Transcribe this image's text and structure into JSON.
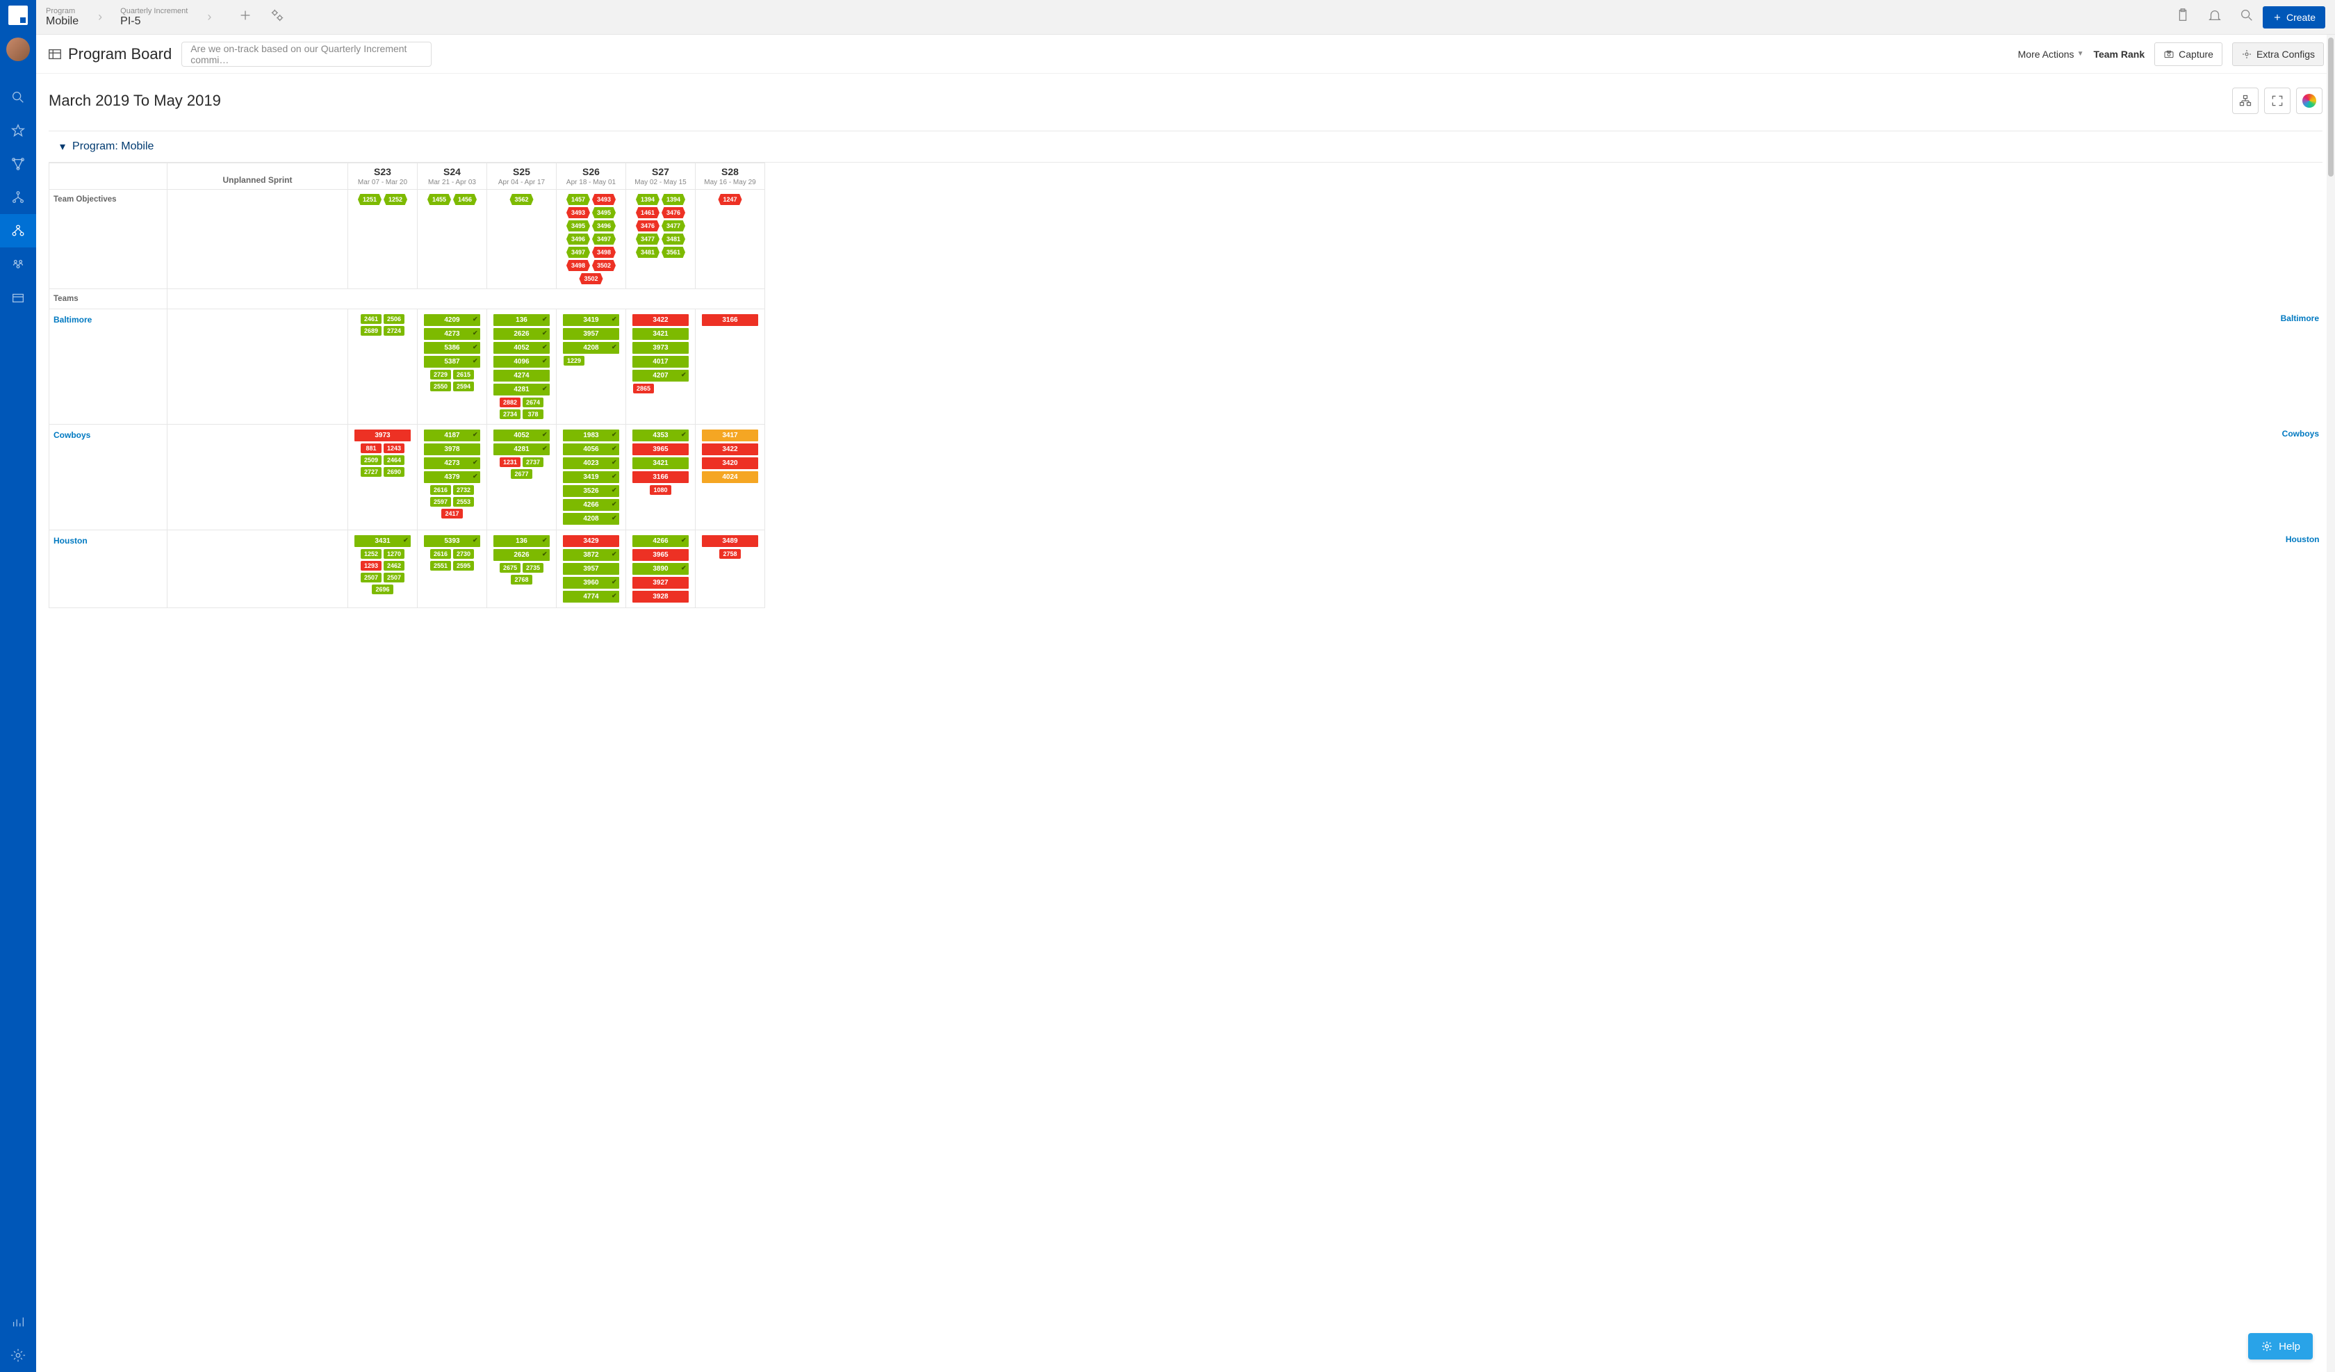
{
  "breadcrumbs": {
    "program_label": "Program",
    "program_value": "Mobile",
    "pi_label": "Quarterly Increment",
    "pi_value": "PI-5"
  },
  "header": {
    "create_label": "Create"
  },
  "page": {
    "title": "Program Board",
    "search_placeholder": "Are we on-track based on our Quarterly Increment commi…",
    "more_actions": "More Actions",
    "team_rank": "Team Rank",
    "capture": "Capture",
    "extra_configs": "Extra Configs",
    "date_range": "March 2019 To May 2019",
    "section_title": "Program: Mobile",
    "help": "Help"
  },
  "columns": {
    "unplanned": "Unplanned Sprint",
    "sprints": [
      {
        "name": "S23",
        "dates": "Mar 07 - Mar 20"
      },
      {
        "name": "S24",
        "dates": "Mar 21 - Apr 03"
      },
      {
        "name": "S25",
        "dates": "Apr 04 - Apr 17"
      },
      {
        "name": "S26",
        "dates": "Apr 18 - May 01"
      },
      {
        "name": "S27",
        "dates": "May 02 - May 15"
      },
      {
        "name": "S28",
        "dates": "May 16 - May 29"
      }
    ]
  },
  "rows": {
    "team_objectives_label": "Team Objectives",
    "teams_label": "Teams",
    "objectives": {
      "S23": [
        {
          "id": "1251",
          "c": "green"
        },
        {
          "id": "1252",
          "c": "green"
        }
      ],
      "S24": [
        {
          "id": "1455",
          "c": "green"
        },
        {
          "id": "1456",
          "c": "green"
        }
      ],
      "S25": [
        {
          "id": "3562",
          "c": "green"
        }
      ],
      "S26": [
        {
          "id": "1457",
          "c": "green"
        },
        {
          "id": "3493",
          "c": "red"
        },
        {
          "id": "3493",
          "c": "red"
        },
        {
          "id": "3495",
          "c": "green"
        },
        {
          "id": "3495",
          "c": "green"
        },
        {
          "id": "3496",
          "c": "green"
        },
        {
          "id": "3496",
          "c": "green"
        },
        {
          "id": "3497",
          "c": "green"
        },
        {
          "id": "3497",
          "c": "green"
        },
        {
          "id": "3498",
          "c": "red"
        },
        {
          "id": "3498",
          "c": "red"
        },
        {
          "id": "3502",
          "c": "red"
        },
        {
          "id": "3502",
          "c": "red"
        }
      ],
      "S27": [
        {
          "id": "1394",
          "c": "green"
        },
        {
          "id": "1394",
          "c": "green"
        },
        {
          "id": "1461",
          "c": "red"
        },
        {
          "id": "3476",
          "c": "red"
        },
        {
          "id": "3476",
          "c": "red"
        },
        {
          "id": "3477",
          "c": "green"
        },
        {
          "id": "3477",
          "c": "green"
        },
        {
          "id": "3481",
          "c": "green"
        },
        {
          "id": "3481",
          "c": "green"
        },
        {
          "id": "3561",
          "c": "green"
        }
      ],
      "S28": [
        {
          "id": "1247",
          "c": "red"
        }
      ]
    },
    "teams": [
      {
        "name": "Baltimore",
        "cells": {
          "S23": {
            "type": "pairs",
            "items": [
              [
                "2461",
                "2506"
              ],
              [
                "2689",
                "2724"
              ]
            ],
            "c": "green"
          },
          "S24": {
            "type": "cards",
            "items": [
              {
                "id": "4209",
                "c": "green",
                "chk": true
              },
              {
                "id": "4273",
                "c": "green",
                "chk": true
              },
              {
                "id": "5386",
                "c": "green",
                "chk": true
              },
              {
                "id": "5387",
                "c": "green",
                "chk": true
              }
            ],
            "pairs": [
              [
                "2729",
                "2615"
              ],
              [
                "2550",
                "2594"
              ]
            ],
            "pc": "green"
          },
          "S25": {
            "type": "cards",
            "items": [
              {
                "id": "136",
                "c": "green",
                "chk": true
              },
              {
                "id": "2626",
                "c": "green",
                "chk": true
              },
              {
                "id": "4052",
                "c": "green",
                "chk": true
              },
              {
                "id": "4096",
                "c": "green",
                "chk": true
              },
              {
                "id": "4274",
                "c": "green"
              },
              {
                "id": "4281",
                "c": "green",
                "chk": true
              }
            ],
            "pairs": [
              [
                "2882",
                "2674"
              ],
              [
                "2734",
                "378"
              ]
            ],
            "pc": "mixed",
            "pcColors": [
              [
                "red",
                "green"
              ],
              [
                "green",
                "green"
              ]
            ]
          },
          "S26": {
            "type": "cards",
            "items": [
              {
                "id": "3419",
                "c": "green",
                "chk": true
              },
              {
                "id": "3957",
                "c": "green"
              },
              {
                "id": "4208",
                "c": "green",
                "chk": true
              }
            ],
            "pairs": [
              [
                "1229",
                ""
              ]
            ],
            "pc": "green-solo"
          },
          "S27": {
            "type": "cards",
            "items": [
              {
                "id": "3422",
                "c": "red"
              },
              {
                "id": "3421",
                "c": "green"
              },
              {
                "id": "3973",
                "c": "green"
              },
              {
                "id": "4017",
                "c": "green"
              },
              {
                "id": "4207",
                "c": "green",
                "chk": true
              }
            ],
            "pairs": [
              [
                "2865",
                ""
              ]
            ],
            "pc": "red-solo"
          },
          "S28": {
            "type": "cards",
            "items": [
              {
                "id": "3166",
                "c": "red"
              }
            ]
          }
        }
      },
      {
        "name": "Cowboys",
        "cells": {
          "S23": {
            "type": "mixed",
            "cards": [
              {
                "id": "3973",
                "c": "red"
              }
            ],
            "pairs": [
              [
                "881",
                "1243"
              ],
              [
                "2509",
                "2464"
              ],
              [
                "2727",
                "2690"
              ]
            ],
            "pcColors": [
              [
                "red",
                "red"
              ],
              [
                "green",
                "green"
              ],
              [
                "green",
                "green"
              ]
            ]
          },
          "S24": {
            "type": "cards",
            "items": [
              {
                "id": "4187",
                "c": "green",
                "chk": true
              },
              {
                "id": "3978",
                "c": "green"
              },
              {
                "id": "4273",
                "c": "green",
                "chk": true
              },
              {
                "id": "4379",
                "c": "green",
                "chk": true
              }
            ],
            "pairs": [
              [
                "2616",
                "2732"
              ],
              [
                "2597",
                "2553"
              ],
              [
                "2417",
                ""
              ]
            ],
            "pcColors": [
              [
                "green",
                "green"
              ],
              [
                "green",
                "green"
              ],
              [
                "red",
                ""
              ]
            ]
          },
          "S25": {
            "type": "cards",
            "items": [
              {
                "id": "4052",
                "c": "green",
                "chk": true
              },
              {
                "id": "4281",
                "c": "green",
                "chk": true
              }
            ],
            "pairs": [
              [
                "1231",
                "2737"
              ],
              [
                "2677",
                ""
              ]
            ],
            "pcColors": [
              [
                "red",
                "green"
              ],
              [
                "green",
                ""
              ]
            ]
          },
          "S26": {
            "type": "cards",
            "items": [
              {
                "id": "1983",
                "c": "green",
                "chk": true
              },
              {
                "id": "4056",
                "c": "green",
                "chk": true
              },
              {
                "id": "4023",
                "c": "green",
                "chk": true
              },
              {
                "id": "3419",
                "c": "green",
                "chk": true
              },
              {
                "id": "3526",
                "c": "green",
                "chk": true
              },
              {
                "id": "4266",
                "c": "green",
                "chk": true
              },
              {
                "id": "4208",
                "c": "green",
                "chk": true
              }
            ]
          },
          "S27": {
            "type": "cards",
            "items": [
              {
                "id": "4353",
                "c": "green",
                "chk": true
              },
              {
                "id": "3965",
                "c": "red"
              },
              {
                "id": "3421",
                "c": "green"
              },
              {
                "id": "3166",
                "c": "red"
              }
            ],
            "pairs": [
              [
                "1080",
                ""
              ]
            ],
            "pcColors": [
              [
                "red",
                ""
              ]
            ]
          },
          "S28": {
            "type": "cards",
            "items": [
              {
                "id": "3417",
                "c": "orange"
              },
              {
                "id": "3422",
                "c": "red"
              },
              {
                "id": "3420",
                "c": "red"
              },
              {
                "id": "4024",
                "c": "orange"
              }
            ]
          }
        }
      },
      {
        "name": "Houston",
        "cells": {
          "S23": {
            "type": "mixed",
            "cards": [
              {
                "id": "3431",
                "c": "green",
                "chk": true
              }
            ],
            "pairs": [
              [
                "1252",
                "1270"
              ],
              [
                "1293",
                "2462"
              ],
              [
                "2507",
                "2507"
              ],
              [
                "2696",
                ""
              ]
            ],
            "pcColors": [
              [
                "green",
                "green"
              ],
              [
                "red",
                "green"
              ],
              [
                "green",
                "green"
              ],
              [
                "green",
                ""
              ]
            ]
          },
          "S24": {
            "type": "cards",
            "items": [
              {
                "id": "5393",
                "c": "green",
                "chk": true
              }
            ],
            "pairs": [
              [
                "2616",
                "2730"
              ],
              [
                "2551",
                "2595"
              ]
            ],
            "pcColors": [
              [
                "green",
                "green"
              ],
              [
                "green",
                "green"
              ]
            ]
          },
          "S25": {
            "type": "cards",
            "items": [
              {
                "id": "136",
                "c": "green",
                "chk": true
              },
              {
                "id": "2626",
                "c": "green",
                "chk": true
              }
            ],
            "pairs": [
              [
                "2675",
                "2735"
              ],
              [
                "2768",
                ""
              ]
            ],
            "pcColors": [
              [
                "green",
                "green"
              ],
              [
                "green",
                ""
              ]
            ]
          },
          "S26": {
            "type": "cards",
            "items": [
              {
                "id": "3429",
                "c": "red"
              },
              {
                "id": "3872",
                "c": "green",
                "chk": true
              },
              {
                "id": "3957",
                "c": "green"
              },
              {
                "id": "3960",
                "c": "green",
                "chk": true
              },
              {
                "id": "4774",
                "c": "green",
                "chk": true
              }
            ]
          },
          "S27": {
            "type": "cards",
            "items": [
              {
                "id": "4266",
                "c": "green",
                "chk": true
              },
              {
                "id": "3965",
                "c": "red"
              },
              {
                "id": "3890",
                "c": "green",
                "chk": true
              },
              {
                "id": "3927",
                "c": "red"
              },
              {
                "id": "3928",
                "c": "red"
              }
            ]
          },
          "S28": {
            "type": "cards",
            "items": [
              {
                "id": "3489",
                "c": "red"
              }
            ],
            "pairs": [
              [
                "2758",
                ""
              ]
            ],
            "pcColors": [
              [
                "red",
                ""
              ]
            ]
          }
        }
      }
    ]
  }
}
